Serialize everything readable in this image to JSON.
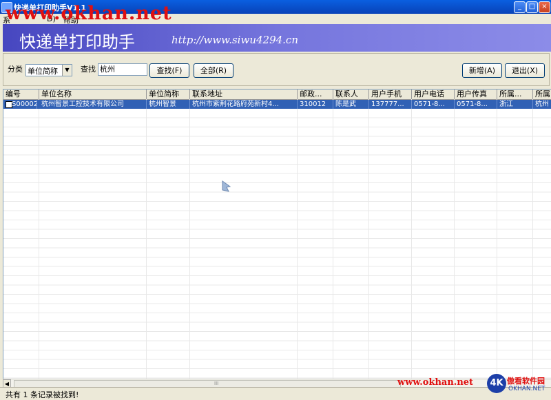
{
  "window": {
    "title": "快递单打印助手V1.1",
    "controls": [
      "_",
      "□",
      "×"
    ]
  },
  "watermark": {
    "top": "www.okhan.net",
    "bottom": "www.okhan.net"
  },
  "menubar": {
    "items": [
      "系",
      "D)",
      "帮助"
    ]
  },
  "banner": {
    "title": "快递单打印助手",
    "url": "http://www.siwu4294.cn"
  },
  "toolbar": {
    "category_label": "分类",
    "category_value": "单位简称",
    "search_label": "查找",
    "search_value": "杭州",
    "find_button": "查找(F)",
    "all_button": "全部(R)",
    "new_button": "新增(A)",
    "exit_button": "退出(X)"
  },
  "table": {
    "columns": [
      "编号",
      "单位名称",
      "单位简称",
      "联系地址",
      "邮政...",
      "联系人",
      "用户手机",
      "用户电话",
      "用户传真",
      "所属...",
      "所属"
    ],
    "rows": [
      [
        "S00002",
        "杭州智景工控技术有限公司",
        "杭州智景",
        "杭州市紫荆花路府苑新村4...",
        "310012",
        "陈是武",
        "137777...",
        "0571-8...",
        "0571-8...",
        "浙江",
        "杭州"
      ]
    ]
  },
  "scrollbar": {
    "grip": "III"
  },
  "status": {
    "text": "共有 1 条记录被找到!"
  },
  "logo": {
    "badge": "4K",
    "cn": "傲看软件园",
    "en": "OKHAN.NET"
  }
}
